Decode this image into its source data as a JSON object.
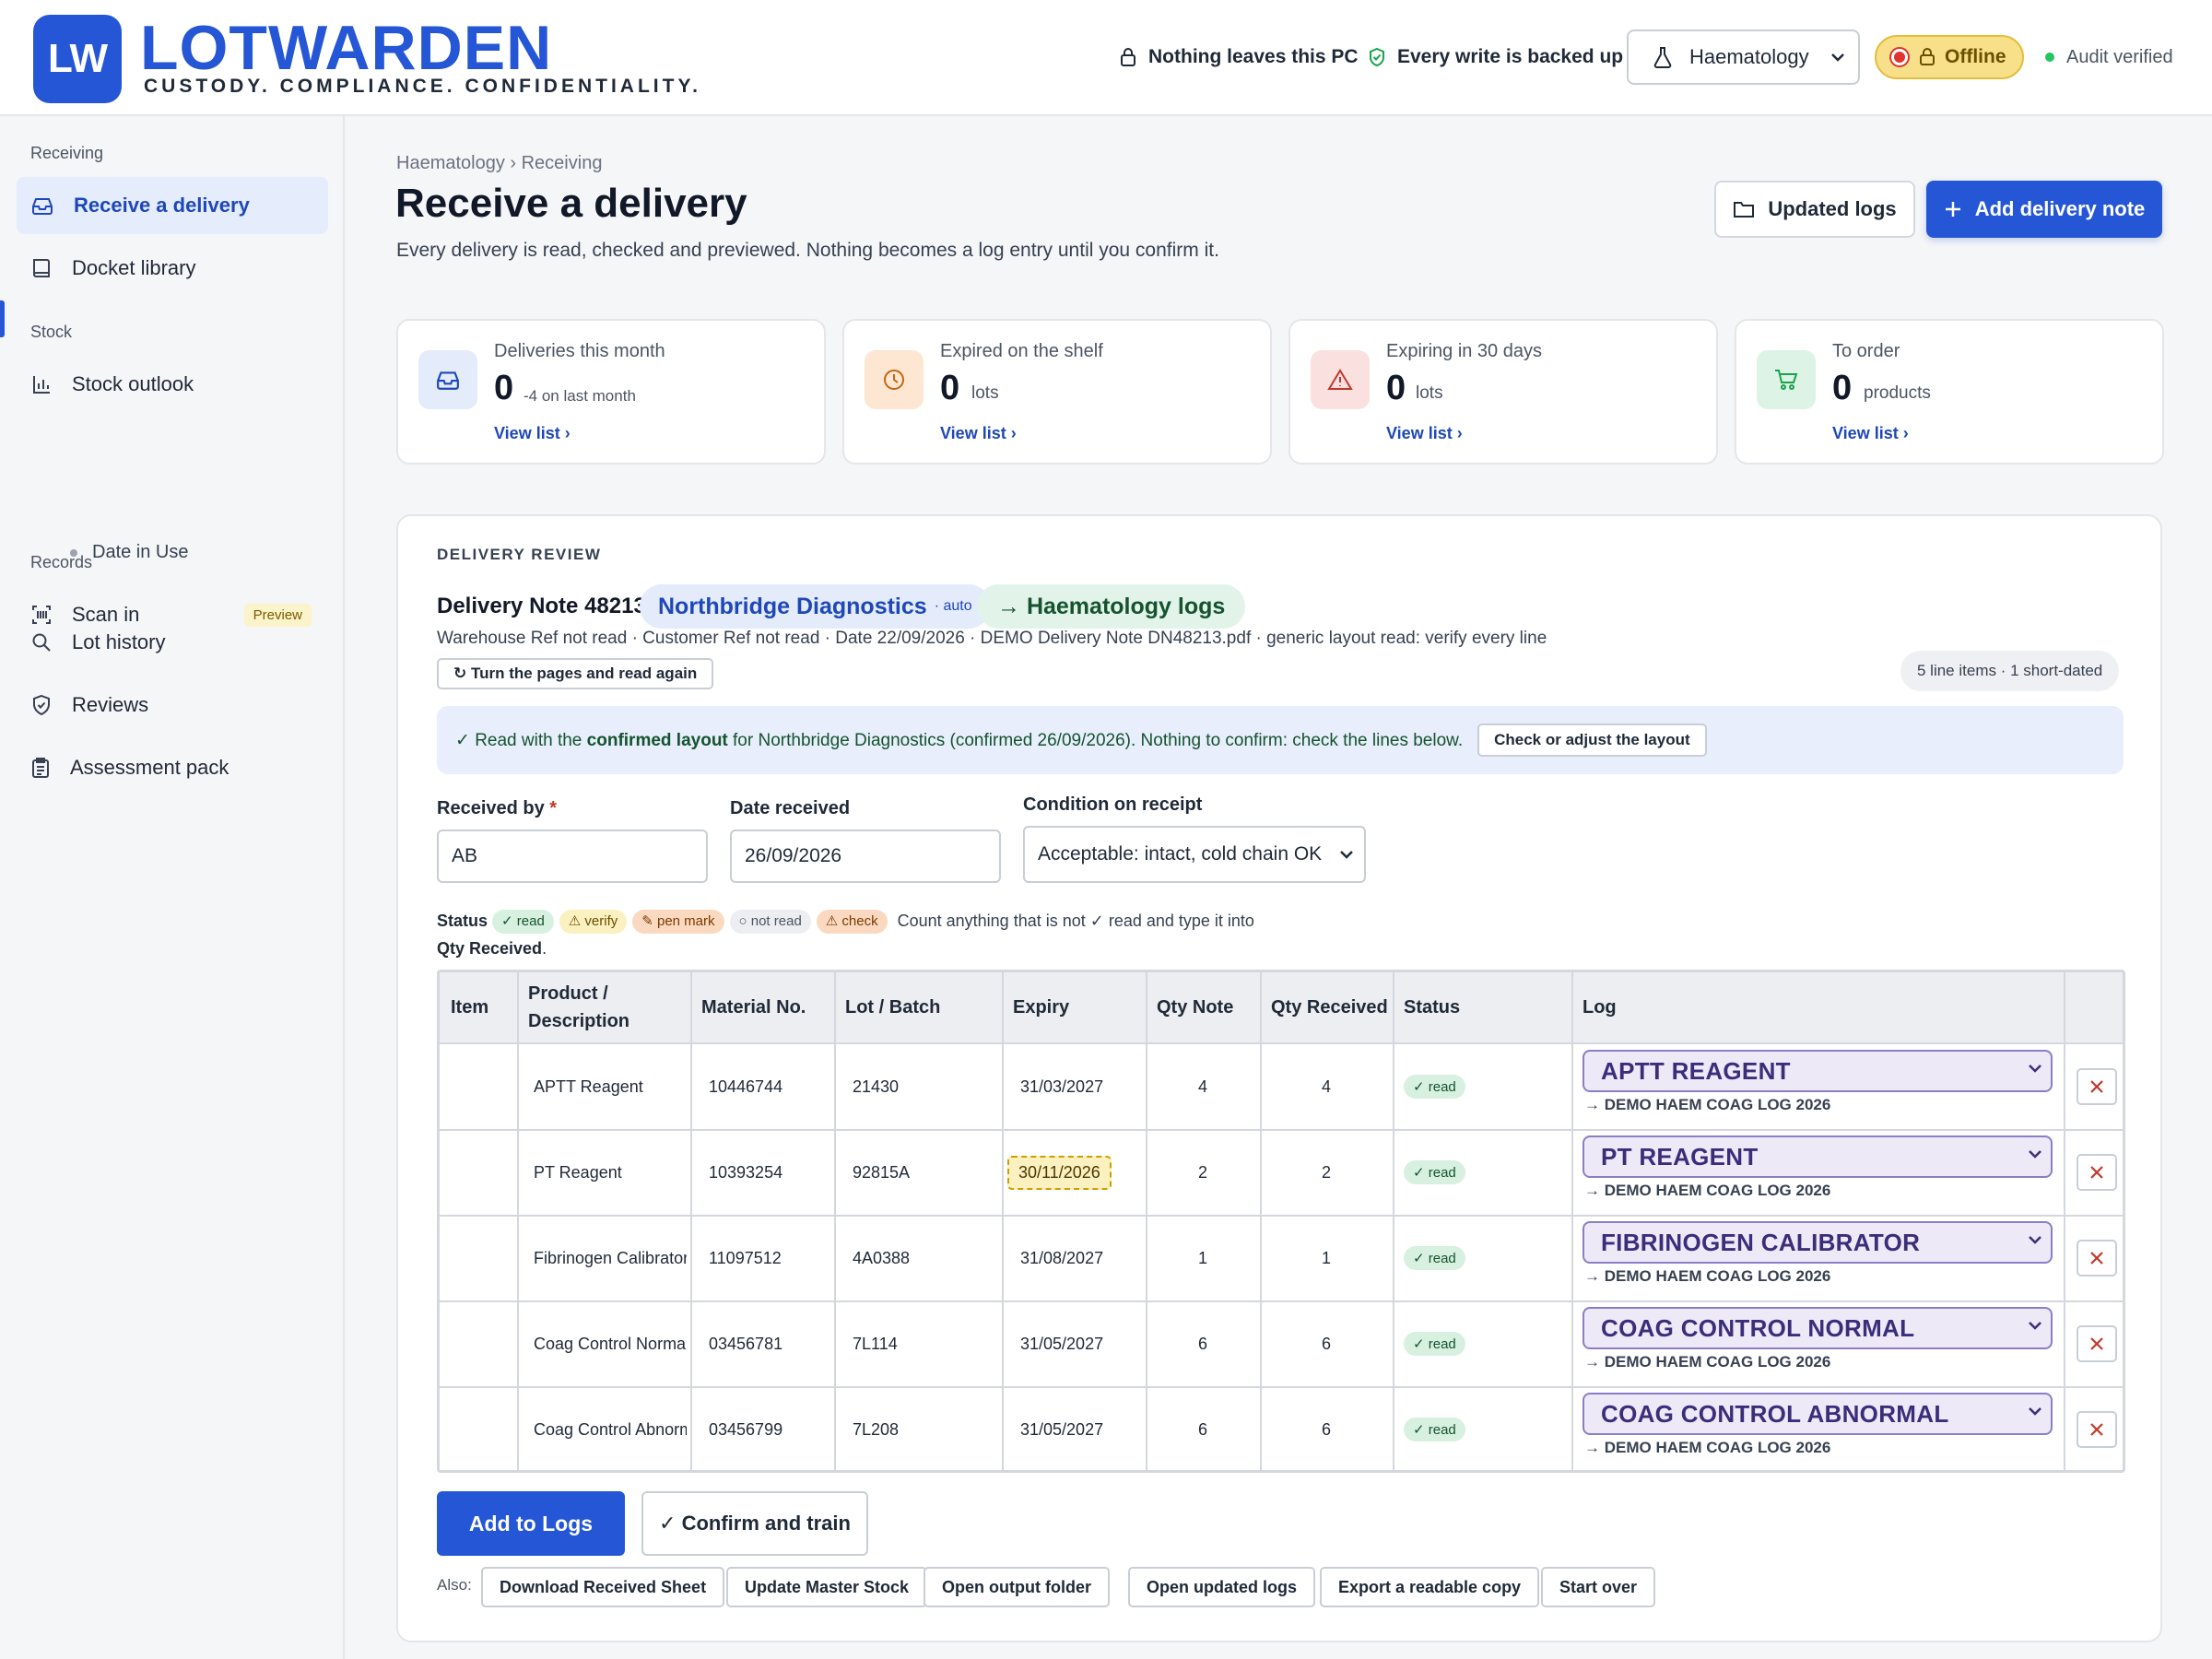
{
  "brand": {
    "badge": "LW",
    "name": "LOTWARDEN",
    "tagline": "CUSTODY. COMPLIANCE. CONFIDENTIALITY."
  },
  "header": {
    "privacy": "Nothing leaves this PC",
    "backup": "Every write is backed up",
    "department": "Haematology",
    "offline": "Offline",
    "audit": "Audit verified",
    "colors": {
      "accent": "#2456d6",
      "offline_bg": "#f8e08a",
      "offline_dot": "#e0322e",
      "audit_dot": "#22c55e"
    }
  },
  "sidebar": {
    "sections": [
      {
        "title": "Receiving",
        "items": [
          {
            "label": "Receive a delivery",
            "icon": "inbox-icon",
            "active": true
          },
          {
            "label": "Docket library",
            "icon": "book-icon"
          }
        ]
      },
      {
        "title": "Stock",
        "items": [
          {
            "label": "Stock outlook",
            "icon": "bar-chart-icon"
          },
          {
            "label": "Date in Use",
            "sub": true
          },
          {
            "label": "Scan in",
            "icon": "barcode-scan-icon",
            "tag": "Preview"
          }
        ]
      },
      {
        "title": "Records",
        "items": [
          {
            "label": "Lot history",
            "icon": "search-icon"
          },
          {
            "label": "Reviews",
            "icon": "shield-check-icon"
          },
          {
            "label": "Assessment pack",
            "icon": "clipboard-icon"
          }
        ]
      }
    ]
  },
  "page": {
    "breadcrumb": "Haematology › Receiving",
    "title": "Receive a delivery",
    "subtitle": "Every delivery is read, checked and previewed. Nothing becomes a log entry until you confirm it.",
    "btn_updated": "Updated logs",
    "btn_add": "Add delivery note"
  },
  "stats": [
    {
      "label": "Deliveries this month",
      "value": "0",
      "unit": "-4 on last month",
      "link": "View list ›",
      "icon": "inbox-icon"
    },
    {
      "label": "Expired on the shelf",
      "value": "0",
      "unit": "lots",
      "link": "View list ›",
      "icon": "clock-icon"
    },
    {
      "label": "Expiring in 30 days",
      "value": "0",
      "unit": "lots",
      "link": "View list ›",
      "icon": "warning-icon"
    },
    {
      "label": "To order",
      "value": "0",
      "unit": "products",
      "link": "View list ›",
      "icon": "cart-icon"
    }
  ],
  "review": {
    "eyebrow": "DELIVERY REVIEW",
    "title": "Delivery Note 48213",
    "supplier": "Northbridge Diagnostics",
    "supplier_tag": "· auto",
    "log_target": "→ Haematology logs",
    "meta": "Warehouse Ref not read · Customer Ref not read · Date 22/09/2026 · DEMO Delivery Note DN48213.pdf · generic layout read: verify every line",
    "btn_turn": "↻ Turn the pages and read again",
    "count": "5 line items · 1 short-dated",
    "banner": {
      "pre": "✓ Read with the ",
      "bold": "confirmed layout",
      "post": " for Northbridge Diagnostics (confirmed 26/09/2026). Nothing to confirm: check the lines below.",
      "btn": "Check or adjust the layout"
    },
    "received_by_label": "Received by",
    "required_mark": "*",
    "received_by": "AB",
    "date_label": "Date received",
    "date": "26/09/2026",
    "condition_label": "Condition on receipt",
    "condition": "Acceptable: intact, cold chain OK",
    "legend": {
      "label": "Status",
      "read": "✓ read",
      "verify": "⚠ verify",
      "pen": "✎ pen mark",
      "notread": "○ not read",
      "check": "⚠ check",
      "text_a": " Count anything that is not ✓ read and type it into ",
      "text_b": "Qty Received",
      "text_c": "."
    },
    "columns": [
      "Item",
      "Product / Description",
      "Material No.",
      "Lot / Batch",
      "Expiry",
      "Qty Note",
      "Qty Received",
      "Status",
      "Log"
    ],
    "rows": [
      {
        "item": "",
        "product": "APTT Reagent",
        "material": "10446744",
        "lot": "21430",
        "expiry": "31/03/2027",
        "qty_note": "4",
        "qty_received": "4",
        "status": "✓ read",
        "log": "APTT REAGENT",
        "dest": "→ DEMO HAEM COAG LOG 2026"
      },
      {
        "item": "",
        "product": "PT Reagent",
        "material": "10393254",
        "lot": "92815A",
        "expiry": "30/11/2026",
        "short_dated": true,
        "qty_note": "2",
        "qty_received": "2",
        "status": "✓ read",
        "log": "PT REAGENT",
        "dest": "→ DEMO HAEM COAG LOG 2026"
      },
      {
        "item": "",
        "product": "Fibrinogen Calibrator",
        "material": "11097512",
        "lot": "4A0388",
        "expiry": "31/08/2027",
        "qty_note": "1",
        "qty_received": "1",
        "status": "✓ read",
        "log": "FIBRINOGEN CALIBRATOR",
        "dest": "→ DEMO HAEM COAG LOG 2026"
      },
      {
        "item": "",
        "product": "Coag Control Normal",
        "material": "03456781",
        "lot": "7L114",
        "expiry": "31/05/2027",
        "qty_note": "6",
        "qty_received": "6",
        "status": "✓ read",
        "log": "COAG CONTROL NORMAL",
        "dest": "→ DEMO HAEM COAG LOG 2026"
      },
      {
        "item": "",
        "product": "Coag Control Abnormal",
        "material": "03456799",
        "lot": "7L208",
        "expiry": "31/05/2027",
        "qty_note": "6",
        "qty_received": "6",
        "status": "✓ read",
        "log": "COAG CONTROL ABNORMAL",
        "dest": "→ DEMO HAEM COAG LOG 2026"
      }
    ],
    "btn_add_logs": "Add to Logs",
    "btn_confirm": "✓ Confirm and train",
    "also_label": "Also:",
    "also": [
      "Download Received Sheet",
      "Update Master Stock",
      "Open output folder",
      "Open updated logs",
      "Export a readable copy",
      "Start over"
    ]
  }
}
